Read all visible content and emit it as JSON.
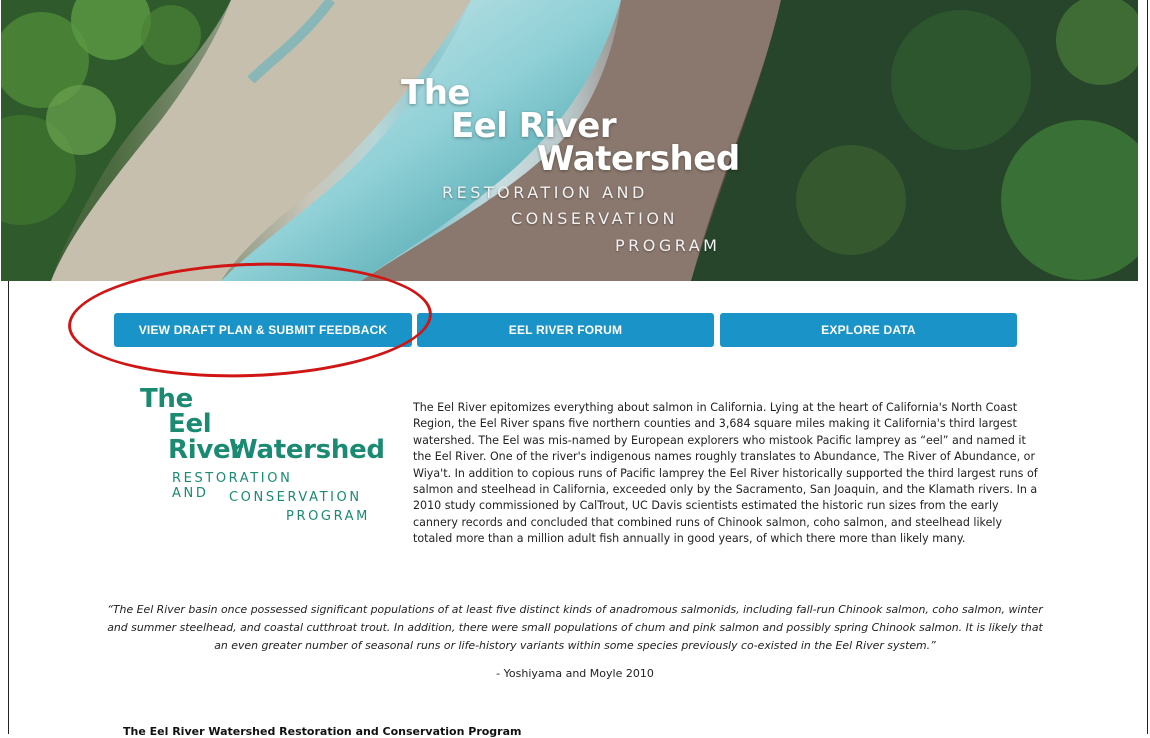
{
  "hero": {
    "title_lines": [
      "The",
      "Eel River",
      "Watershed"
    ],
    "subtitle_lines": [
      "RESTORATION AND",
      "CONSERVATION",
      "PROGRAM"
    ]
  },
  "nav_buttons": [
    {
      "label": "VIEW DRAFT PLAN & SUBMIT FEEDBACK"
    },
    {
      "label": "EEL RIVER FORUM"
    },
    {
      "label": "EXPLORE DATA"
    }
  ],
  "logo": {
    "title_lines": [
      "The",
      "Eel River",
      "Watershed"
    ],
    "subtitle_lines": [
      "RESTORATION AND",
      "CONSERVATION",
      "PROGRAM"
    ]
  },
  "intro_text": "The Eel River epitomizes everything about salmon in California. Lying at the heart of California's North Coast Region, the Eel River spans five northern counties and 3,684 square miles making it California's third largest watershed. The Eel was mis-named by European explorers who mistook Pacific lamprey as “eel” and named it the Eel River. One of the river's indigenous names roughly translates to Abundance, The River of Abundance, or Wiya't. In addition to copious runs of Pacific lamprey the Eel River historically supported the third largest runs of salmon and steelhead in California, exceeded only by the Sacramento, San Joaquin, and the Klamath rivers. In a 2010 study commissioned by CalTrout, UC Davis scientists estimated the historic run sizes from the early cannery records and concluded that combined runs of Chinook salmon, coho salmon, and steelhead likely totaled more than a million adult fish annually in good years, of which there more than likely many.",
  "quote": "“The Eel River basin once possessed significant populations of at least five distinct kinds of anadromous salmonids, including fall-run Chinook salmon, coho salmon, winter and summer steelhead, and coastal cutthroat trout. In addition, there were small populations of chum and pink salmon and possibly spring Chinook salmon. It is likely that an even greater number of seasonal runs or life-history variants within some species previously co-existed in the Eel River system.”",
  "quote_citation": "- Yoshiyama and Moyle 2010",
  "section_title": "The Eel River Watershed Restoration and Conservation Program",
  "colors": {
    "button_blue": "#1a94c8",
    "logo_green": "#1a8a72",
    "annotation_red": "#d01515"
  }
}
